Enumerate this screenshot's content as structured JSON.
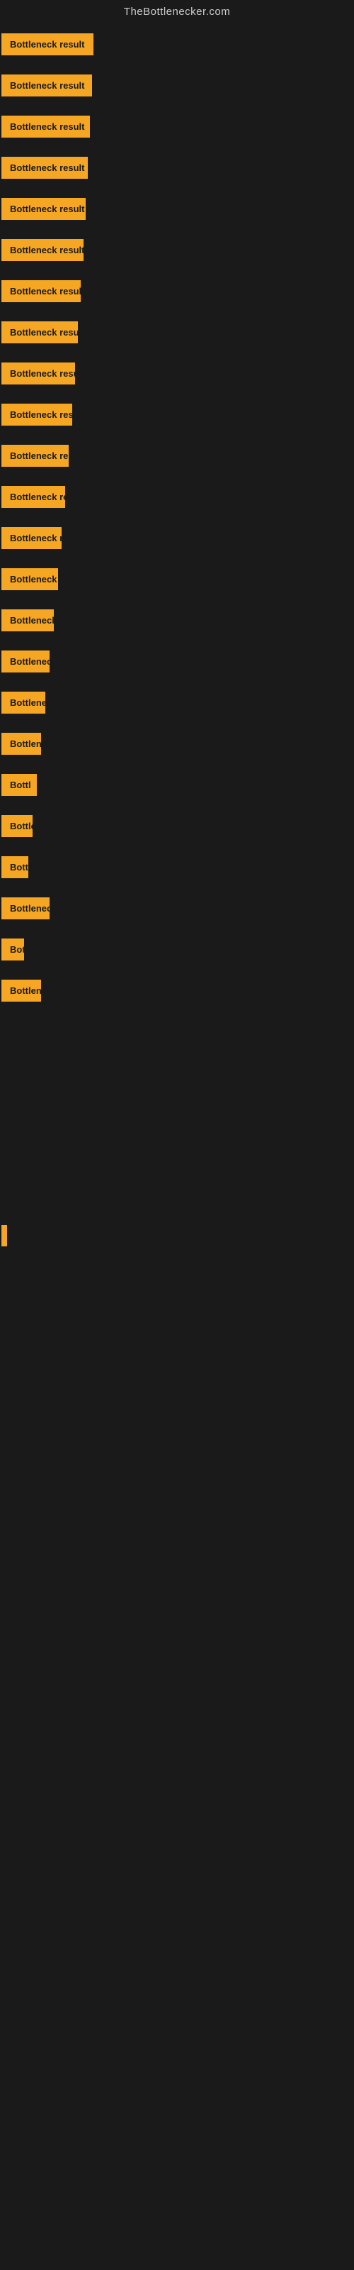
{
  "site": {
    "title": "TheBottlenecker.com"
  },
  "items": [
    {
      "label": "Bottleneck result",
      "widthClass": "w-full"
    },
    {
      "label": "Bottleneck result",
      "widthClass": "w-1"
    },
    {
      "label": "Bottleneck result",
      "widthClass": "w-2"
    },
    {
      "label": "Bottleneck result",
      "widthClass": "w-3"
    },
    {
      "label": "Bottleneck result",
      "widthClass": "w-4"
    },
    {
      "label": "Bottleneck result",
      "widthClass": "w-5"
    },
    {
      "label": "Bottleneck result",
      "widthClass": "w-6"
    },
    {
      "label": "Bottleneck result",
      "widthClass": "w-7"
    },
    {
      "label": "Bottleneck result",
      "widthClass": "w-8"
    },
    {
      "label": "Bottleneck result",
      "widthClass": "w-9"
    },
    {
      "label": "Bottleneck result",
      "widthClass": "w-10"
    },
    {
      "label": "Bottleneck result",
      "widthClass": "w-11"
    },
    {
      "label": "Bottleneck result",
      "widthClass": "w-12"
    },
    {
      "label": "Bottleneck result",
      "widthClass": "w-13"
    },
    {
      "label": "Bottleneck res",
      "widthClass": "w-14"
    },
    {
      "label": "Bottlenec",
      "widthClass": "w-15"
    },
    {
      "label": "Bottleneck r",
      "widthClass": "w-16"
    },
    {
      "label": "Bottlene",
      "widthClass": "w-17"
    },
    {
      "label": "Bottl",
      "widthClass": "w-18"
    },
    {
      "label": "Bottlene",
      "widthClass": "w-19"
    },
    {
      "label": "Bottlen",
      "widthClass": "w-20"
    },
    {
      "label": "Bottleneck",
      "widthClass": "w-15"
    },
    {
      "label": "Bott",
      "widthClass": "w-21"
    },
    {
      "label": "Bottlene",
      "widthClass": "w-17"
    }
  ],
  "colors": {
    "background": "#1a1a1a",
    "badge": "#f5a623",
    "text": "#1a1a1a",
    "siteTitle": "#cccccc"
  }
}
